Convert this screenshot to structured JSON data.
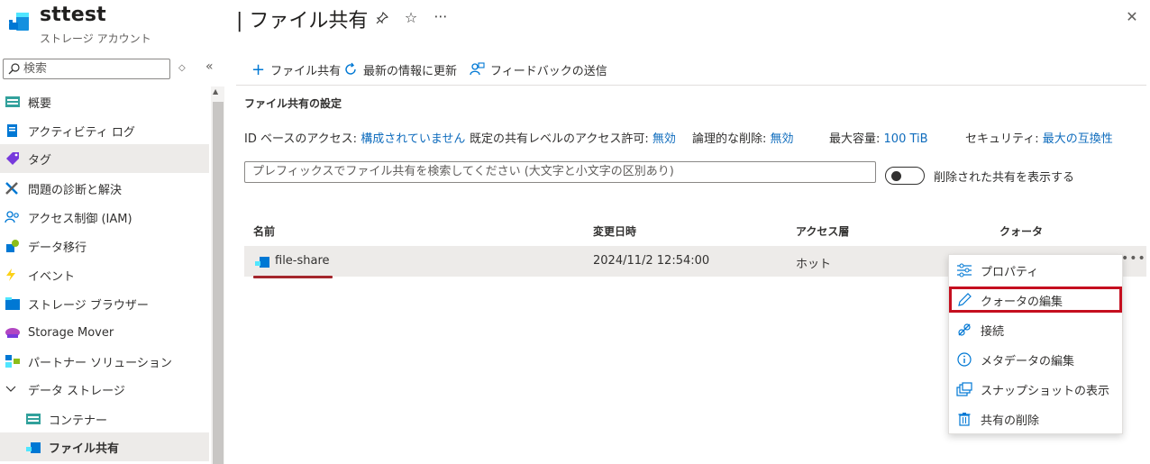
{
  "header": {
    "resource_name": "sttest",
    "resource_type": "ストレージ アカウント",
    "page_title": "| ファイル共有",
    "icons": [
      "storage-account-icon",
      "pin-icon",
      "star-icon",
      "more-icon",
      "close-icon"
    ]
  },
  "sidebar": {
    "search_placeholder": "検索",
    "items": [
      {
        "label": "概要",
        "icon": "overview-icon"
      },
      {
        "label": "アクティビティ ログ",
        "icon": "activity-log-icon"
      },
      {
        "label": "タグ",
        "icon": "tag-icon"
      },
      {
        "label": "問題の診断と解決",
        "icon": "diagnose-icon"
      },
      {
        "label": "アクセス制御 (IAM)",
        "icon": "iam-icon"
      },
      {
        "label": "データ移行",
        "icon": "data-migration-icon"
      },
      {
        "label": "イベント",
        "icon": "event-icon"
      },
      {
        "label": "ストレージ ブラウザー",
        "icon": "storage-browser-icon"
      },
      {
        "label": "Storage Mover",
        "icon": "storage-mover-icon"
      },
      {
        "label": "パートナー ソリューション",
        "icon": "partner-icon"
      },
      {
        "label": "データ ストレージ",
        "icon": "chevron-down-icon"
      },
      {
        "label": "コンテナー",
        "icon": "container-icon"
      },
      {
        "label": "ファイル共有",
        "icon": "file-share-icon"
      }
    ]
  },
  "toolbar": {
    "add_label": "ファイル共有",
    "refresh_label": "最新の情報に更新",
    "feedback_label": "フィードバックの送信"
  },
  "settings": {
    "heading": "ファイル共有の設定",
    "identity_label": "ID ベースのアクセス:",
    "identity_value": "構成されていません",
    "default_label": "既定の共有レベルのアクセス許可:",
    "default_value": "無効",
    "softdelete_label": "論理的な削除:",
    "softdelete_value": "無効",
    "capacity_label": "最大容量:",
    "capacity_value": "100 TiB",
    "security_label": "セキュリティ:",
    "security_value": "最大の互換性"
  },
  "filter": {
    "placeholder": "プレフィックスでファイル共有を検索してください (大文字と小文字の区別あり)",
    "toggle_label": "削除された共有を表示する",
    "toggle_on": false
  },
  "table": {
    "columns": [
      "名前",
      "変更日時",
      "アクセス層",
      "クォータ"
    ],
    "rows": [
      {
        "name": "file-share",
        "modified": "2024/11/2 12:54:00",
        "tier": "ホット",
        "quota": ""
      }
    ]
  },
  "context_menu": {
    "items": [
      {
        "label": "プロパティ",
        "icon": "properties-icon"
      },
      {
        "label": "クォータの編集",
        "icon": "edit-icon",
        "highlighted": true
      },
      {
        "label": "接続",
        "icon": "connect-icon"
      },
      {
        "label": "メタデータの編集",
        "icon": "info-icon"
      },
      {
        "label": "スナップショットの表示",
        "icon": "snapshot-icon"
      },
      {
        "label": "共有の削除",
        "icon": "delete-icon"
      }
    ]
  },
  "colors": {
    "link": "#0f6cbd",
    "accent": "#0078d4",
    "highlight": "#c50f1f"
  }
}
